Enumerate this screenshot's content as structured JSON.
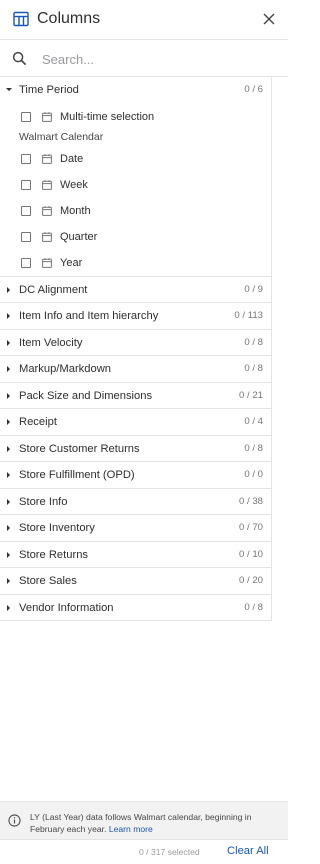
{
  "header": {
    "title": "Columns"
  },
  "search": {
    "placeholder": "Search..."
  },
  "time_period": {
    "label": "Time Period",
    "count": "0 / 6",
    "multi_time": "Multi-time selection",
    "calendar_label": "Walmart Calendar",
    "items": [
      "Date",
      "Week",
      "Month",
      "Quarter",
      "Year"
    ]
  },
  "groups": [
    {
      "label": "DC Alignment",
      "count": "0 / 9"
    },
    {
      "label": "Item Info and Item hierarchy",
      "count": "0 / 113"
    },
    {
      "label": "Item Velocity",
      "count": "0 / 8"
    },
    {
      "label": "Markup/Markdown",
      "count": "0 / 8"
    },
    {
      "label": "Pack Size and Dimensions",
      "count": "0 / 21"
    },
    {
      "label": "Receipt",
      "count": "0 / 4"
    },
    {
      "label": "Store Customer Returns",
      "count": "0 / 8"
    },
    {
      "label": "Store Fulfillment (OPD)",
      "count": "0 / 0"
    },
    {
      "label": "Store Info",
      "count": "0 / 38"
    },
    {
      "label": "Store Inventory",
      "count": "0 / 70"
    },
    {
      "label": "Store Returns",
      "count": "0 / 10"
    },
    {
      "label": "Store Sales",
      "count": "0 / 20"
    },
    {
      "label": "Vendor Information",
      "count": "0 / 8"
    }
  ],
  "footer": {
    "note": "LY (Last Year) data follows Walmart calendar, beginning in February each year.",
    "learn_more": "Learn more",
    "selected": "0 / 317 selected",
    "clear_all": "Clear All"
  },
  "colors": {
    "link": "#1a56b8",
    "text": "#2e2f32",
    "muted": "#74767c",
    "divider": "#e3e4e5"
  }
}
